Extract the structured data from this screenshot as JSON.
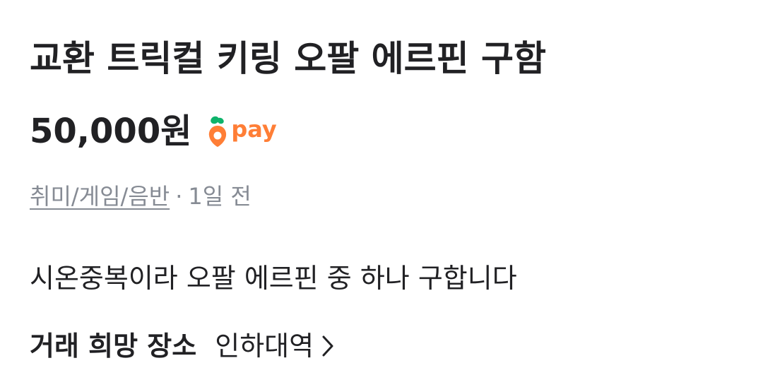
{
  "item": {
    "title": "교환 트릭컬 키링 오팔 에르핀 구함",
    "price": "50,000원",
    "pay_badge": {
      "icon": "carrot-icon",
      "label": "pay",
      "color": "#ff7e36"
    },
    "category": "취미/게임/음반",
    "separator": "·",
    "posted_time": "1일 전",
    "description": "시온중복이라 오팔 에르핀 중 하나 구합니다",
    "trade_place": {
      "label": "거래 희망 장소",
      "value": "인하대역",
      "icon": "chevron-right-icon"
    }
  }
}
